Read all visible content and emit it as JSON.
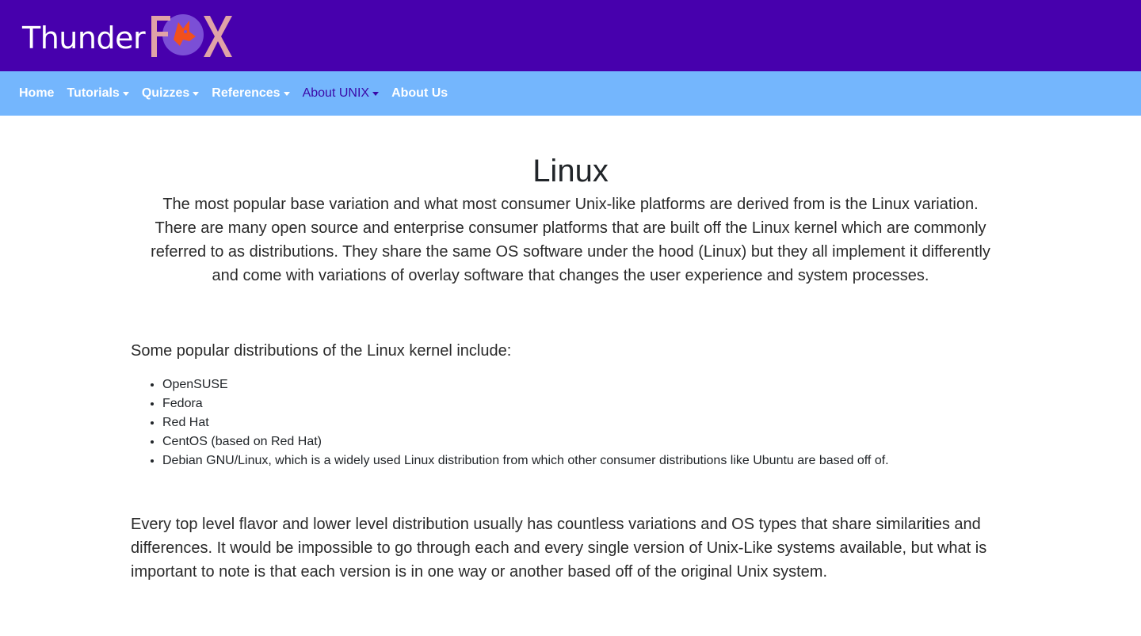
{
  "brand": {
    "name_prefix": "Thunder",
    "name_suffix": "FOX",
    "colors": {
      "header_bg": "#4700ad",
      "nav_bg": "#74b6fd",
      "logo_letters": "#e0a3a7",
      "fox": "#f2501d",
      "fox_circle": "#7b4fd6"
    }
  },
  "nav": {
    "items": [
      {
        "label": "Home",
        "dropdown": false,
        "active": false
      },
      {
        "label": "Tutorials",
        "dropdown": true,
        "active": false
      },
      {
        "label": "Quizzes",
        "dropdown": true,
        "active": false
      },
      {
        "label": "References",
        "dropdown": true,
        "active": false
      },
      {
        "label": "About UNIX",
        "dropdown": true,
        "active": true
      },
      {
        "label": "About Us",
        "dropdown": false,
        "active": false
      }
    ]
  },
  "content": {
    "title": "Linux",
    "intro": "The most popular base variation and what most consumer Unix-like platforms are derived from is the Linux variation. There are many open source and enterprise consumer platforms that are built off the Linux kernel which are commonly referred to as distributions. They share the same OS software under the hood (Linux) but they all implement it differently and come with variations of overlay software that changes the user experience and system processes.",
    "list_heading": "Some popular distributions of the Linux kernel include:",
    "distributions": [
      "OpenSUSE",
      "Fedora",
      "Red Hat",
      "CentOS (based on Red Hat)",
      "Debian GNU/Linux, which is a widely used Linux distribution from which other consumer distributions like Ubuntu are based off of."
    ],
    "closing": "Every top level flavor and lower level distribution usually has countless variations and OS types that share similarities and differences. It would be impossible to go through each and every single version of Unix-Like systems available, but what is important to note is that each version is in one way or another based off of the original Unix system."
  }
}
